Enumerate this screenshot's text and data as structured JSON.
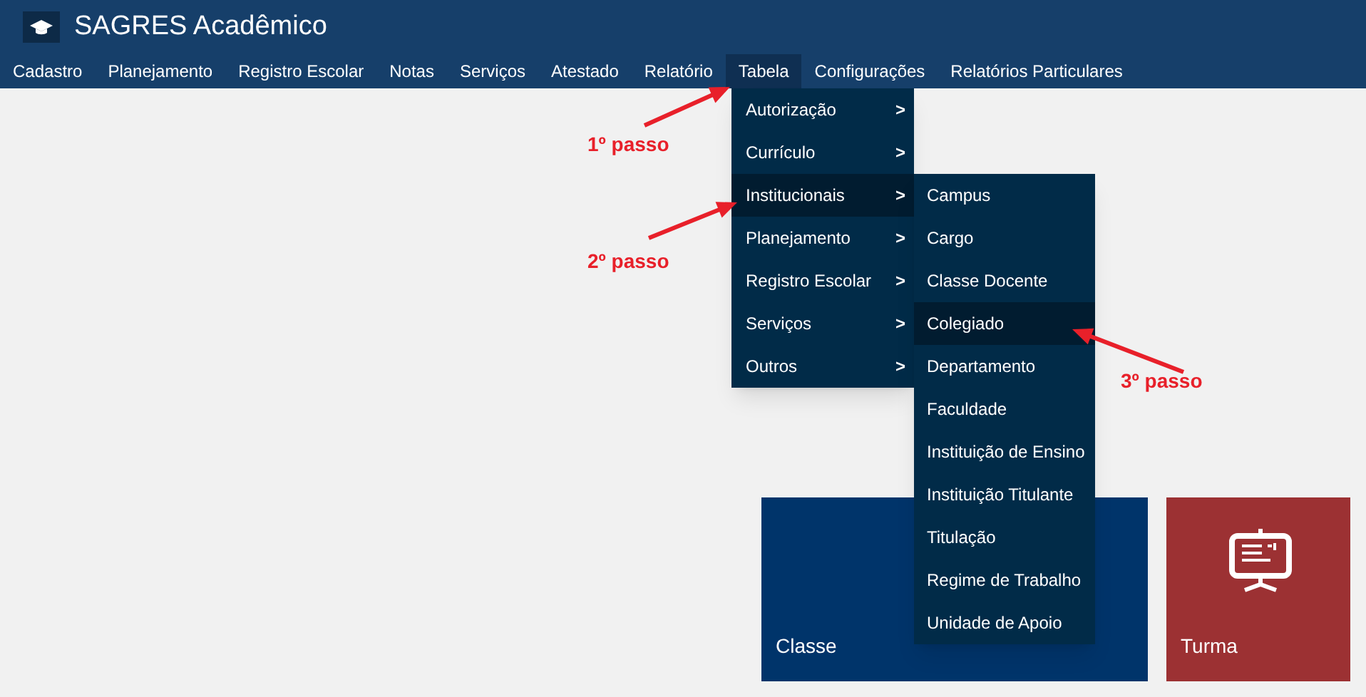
{
  "app": {
    "title": "SAGRES Acadêmico"
  },
  "menu": [
    {
      "label": "Cadastro",
      "selected": false
    },
    {
      "label": "Planejamento",
      "selected": false
    },
    {
      "label": "Registro Escolar",
      "selected": false
    },
    {
      "label": "Notas",
      "selected": false
    },
    {
      "label": "Serviços",
      "selected": false
    },
    {
      "label": "Atestado",
      "selected": false
    },
    {
      "label": "Relatório",
      "selected": false
    },
    {
      "label": "Tabela",
      "selected": true
    },
    {
      "label": "Configurações",
      "selected": false
    },
    {
      "label": "Relatórios Particulares",
      "selected": false
    }
  ],
  "dropdown": [
    {
      "label": "Autorização",
      "selected": false
    },
    {
      "label": "Currículo",
      "selected": false
    },
    {
      "label": "Institucionais",
      "selected": true
    },
    {
      "label": "Planejamento",
      "selected": false
    },
    {
      "label": "Registro Escolar",
      "selected": false
    },
    {
      "label": "Serviços",
      "selected": false
    },
    {
      "label": "Outros",
      "selected": false
    }
  ],
  "dropdown_chevron": ">",
  "submenu": [
    {
      "label": "Campus",
      "selected": false
    },
    {
      "label": "Cargo",
      "selected": false
    },
    {
      "label": "Classe Docente",
      "selected": false
    },
    {
      "label": "Colegiado",
      "selected": true
    },
    {
      "label": "Departamento",
      "selected": false
    },
    {
      "label": "Faculdade",
      "selected": false
    },
    {
      "label": "Instituição de Ensino",
      "selected": false
    },
    {
      "label": "Instituição Titulante",
      "selected": false
    },
    {
      "label": "Titulação",
      "selected": false
    },
    {
      "label": "Regime de Trabalho",
      "selected": false
    },
    {
      "label": "Unidade de Apoio",
      "selected": false
    }
  ],
  "tiles": [
    {
      "label": "Classe",
      "color": "#00346a"
    },
    {
      "label": "Turma",
      "color": "#9c3133"
    }
  ],
  "annotations": [
    {
      "label": "1º passo"
    },
    {
      "label": "2º passo"
    },
    {
      "label": "3º passo"
    }
  ]
}
